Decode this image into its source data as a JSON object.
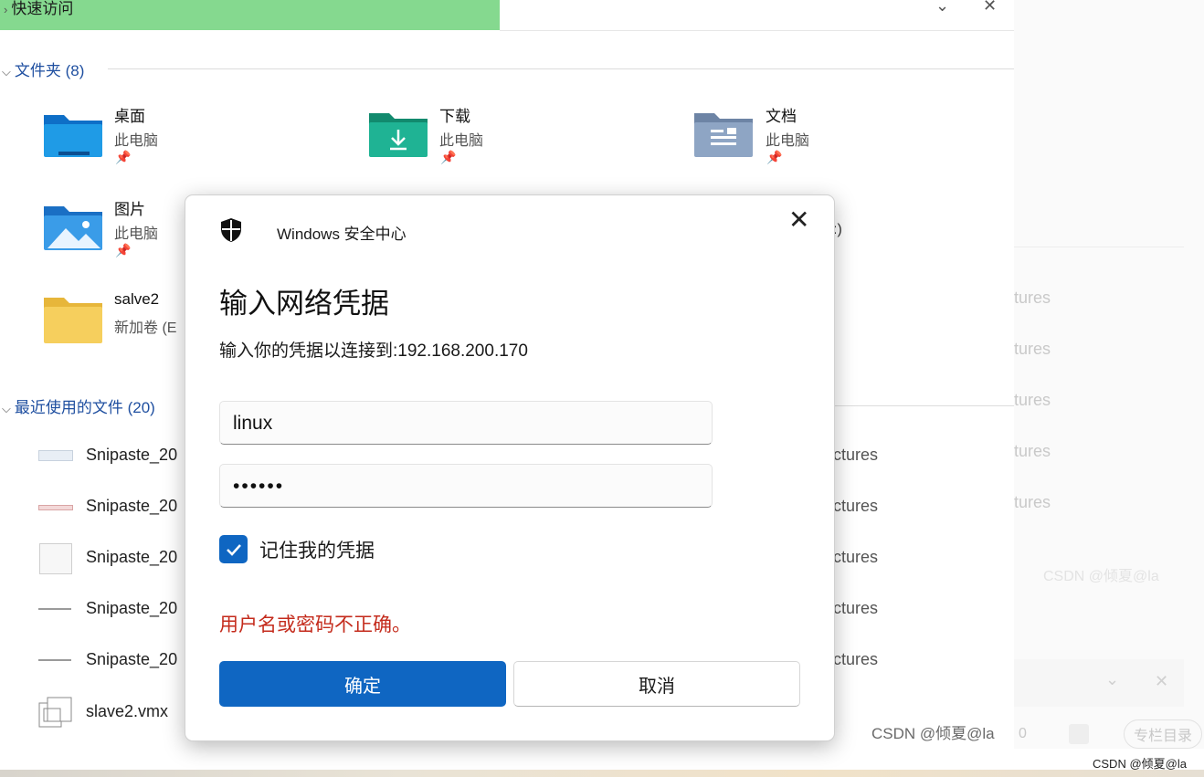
{
  "quick_access": {
    "label": "快速访问"
  },
  "explorer_controls": {
    "chevron": "⌄",
    "close": "✕"
  },
  "sections": {
    "folders_header": "文件夹 (8)",
    "recent_header": "最近使用的文件 (20)"
  },
  "folders": [
    {
      "name": "桌面",
      "location": "此电脑",
      "icon": "desktop-folder-icon",
      "color": "#1f84d8"
    },
    {
      "name": "下载",
      "location": "此电脑",
      "icon": "downloads-folder-icon",
      "color": "#1aa888"
    },
    {
      "name": "文档",
      "location": "此电脑",
      "icon": "documents-folder-icon",
      "color": "#7f97b8"
    },
    {
      "name": "图片",
      "location": "此电脑",
      "icon": "pictures-folder-icon",
      "color": "#2a8ee0"
    },
    {
      "name": "salve2",
      "location": "新加卷 (E",
      "icon": "folder-icon",
      "color": "#f2c94c"
    }
  ],
  "hidden_fragment": ":)",
  "recent_files": [
    {
      "name": "Snipaste_20",
      "location": "ctures"
    },
    {
      "name": "Snipaste_20",
      "location": "ctures"
    },
    {
      "name": "Snipaste_20",
      "location": "ctures"
    },
    {
      "name": "Snipaste_20",
      "location": "ctures"
    },
    {
      "name": "Snipaste_20",
      "location": "ctures"
    },
    {
      "name": "slave2.vmx",
      "location": ""
    }
  ],
  "background_ghost": [
    "tures",
    "tures",
    "tures",
    "tures",
    "tures"
  ],
  "watermarks": {
    "main": "CSDN @倾夏@la",
    "faint": "CSDN @倾夏@la",
    "corner": "CSDN @倾夏@la"
  },
  "right_panel": {
    "count": "0",
    "toc_button": "专栏目录"
  },
  "dialog": {
    "app_name": "Windows 安全中心",
    "title": "输入网络凭据",
    "description": "输入你的凭据以连接到:192.168.200.170",
    "username": "linux",
    "password": "••••••",
    "remember_label": "记住我的凭据",
    "remember_checked": true,
    "error": "用户名或密码不正确。",
    "ok_label": "确定",
    "cancel_label": "取消",
    "accent_color": "#0f66c2",
    "error_color": "#c42b1c"
  }
}
